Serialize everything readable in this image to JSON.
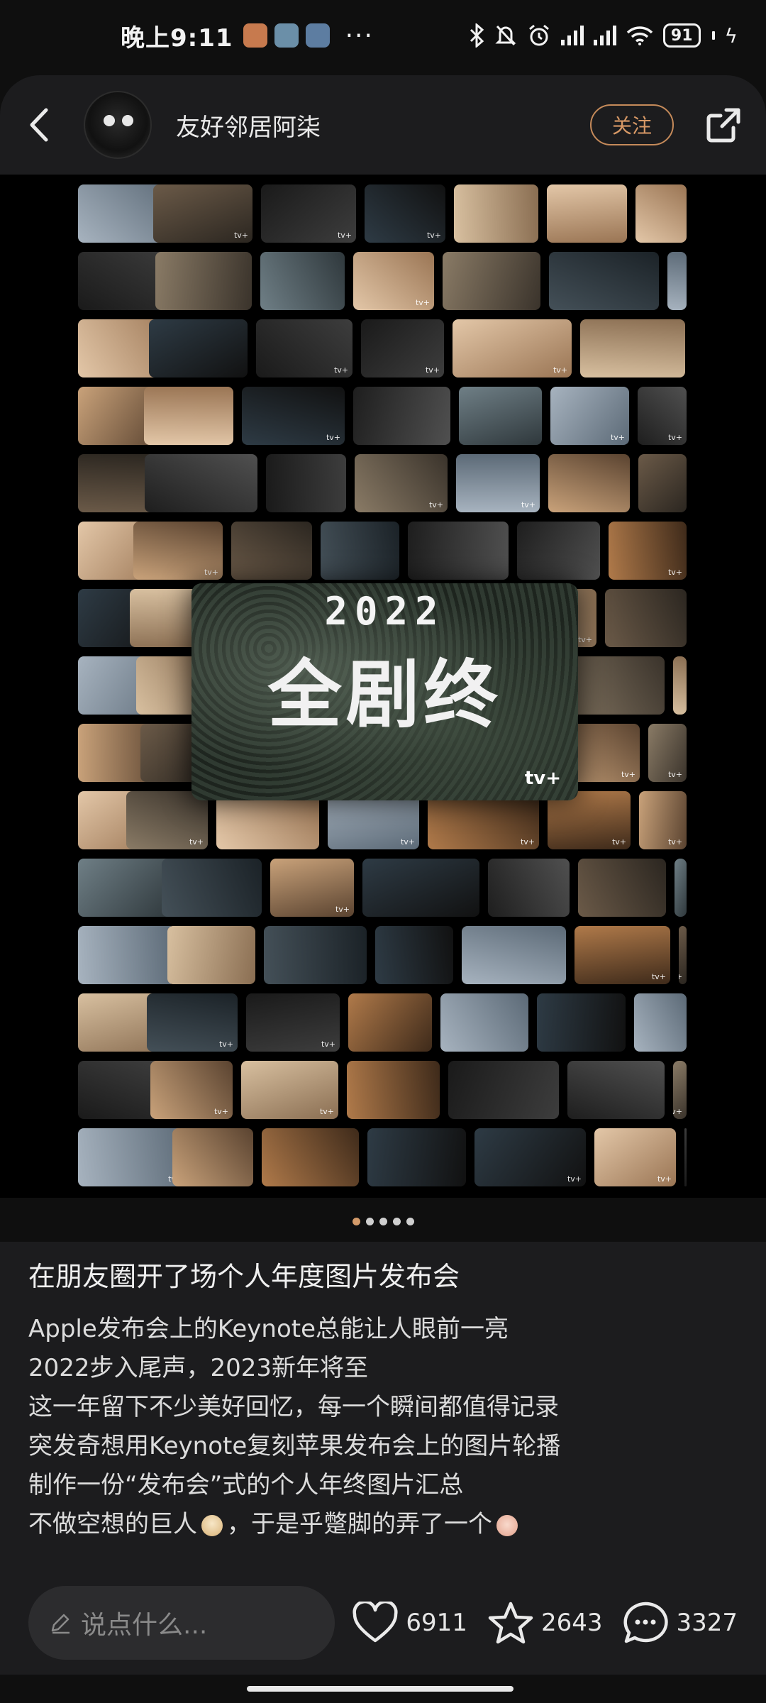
{
  "status_bar": {
    "time": "晚上9:11",
    "more": "···",
    "battery": "91"
  },
  "header": {
    "username": "友好邻居阿柒",
    "follow_label": "关注"
  },
  "feature_card": {
    "year": "2022",
    "title": "全剧终",
    "brand": " tv+"
  },
  "thumb_brand": "tv+",
  "pager": {
    "count": 5,
    "active": 0
  },
  "post": {
    "title": "在朋友圈开了场个人年度图片发布会",
    "lines": [
      "Apple发布会上的Keynote总能让人眼前一亮",
      "2022步入尾声，2023新年将至",
      "这一年留下不少美好回忆，每一个瞬间都值得记录",
      "突发奇想用Keynote复刻苹果发布会上的图片轮播",
      "制作一份“发布会”式的个人年终图片汇总"
    ],
    "last_line_a": "不做空想的巨人",
    "last_line_b": "，于是乎蹩脚的弄了一个"
  },
  "bottom_bar": {
    "comment_placeholder": "说点什么...",
    "likes": "6911",
    "favorites": "2643",
    "comments": "3327"
  },
  "colors": {
    "accent": "#d89966",
    "background": "#1c1c1e"
  }
}
